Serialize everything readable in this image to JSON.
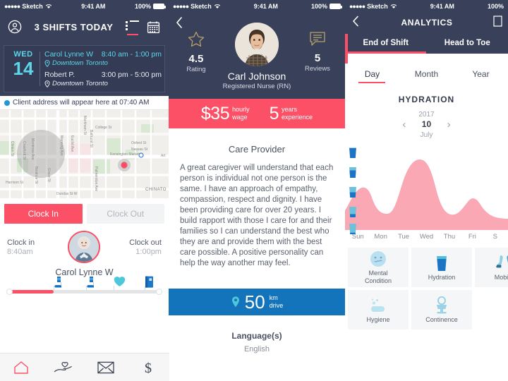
{
  "statusbar": {
    "carrier": "Sketch",
    "dots": "●●●●●",
    "time": "9:41 AM",
    "battery": "100%"
  },
  "colors": {
    "navy": "#39405a",
    "accent_red": "#fb5066",
    "cyan": "#5fd6e8",
    "blue": "#1373bb",
    "pink_area": "#f9a8b4"
  },
  "panel1": {
    "name": "shifts-screen",
    "header": {
      "title": "3 SHIFTS TODAY",
      "profile_icon": "person-circle-icon",
      "list_icon": "list-view-icon",
      "calendar_icon": "calendar-icon"
    },
    "shift_card": {
      "day_of_week": "WED",
      "day_number": "14",
      "shifts": [
        {
          "client": "Carol Lynne W",
          "time": "8:40 am - 1:00 pm",
          "location": "Downtown Toronto",
          "state": "active"
        },
        {
          "client": "Robert P.",
          "time": "3:00 pm - 5:00 pm",
          "location": "Downtown Toronto",
          "state": "idle"
        }
      ]
    },
    "address_bar": {
      "text": "Client address will appear here at 07:40 AM",
      "dot_icon": "location-dot-icon"
    },
    "map": {
      "marker_label": "Kensington Market",
      "district_label": "CHINATO",
      "streets": [
        "College St",
        "Oxford St",
        "Nassau St",
        "Dundas St W",
        "Bathurst St",
        "Euclid Ave",
        "Manning Ave",
        "Markham St",
        "Palmerston Ave",
        "Grace St",
        "Crawford St",
        "Beatrice St",
        "Montrose Ave",
        "Harrison St",
        "Clinton St",
        "Art"
      ]
    },
    "buttons": {
      "clock_in": "Clock In",
      "clock_out": "Clock Out"
    },
    "clock_info": {
      "in_label": "Clock in",
      "in_value": "8:40am",
      "out_label": "Clock out",
      "out_value": "1:00pm",
      "client_name": "Carol Lynne W",
      "avatar_icon": "client-avatar"
    },
    "progress": {
      "fill_percent": 30,
      "markers": [
        {
          "icon": "boot-icon",
          "position": 38
        },
        {
          "icon": "boot-icon",
          "position": 57
        },
        {
          "icon": "heart-icon",
          "position": 74
        },
        {
          "icon": "book-icon",
          "position": 92
        }
      ]
    },
    "tabbar": [
      {
        "icon": "home-icon",
        "name": "tab-home",
        "active": true
      },
      {
        "icon": "care-hand-heart-icon",
        "name": "tab-care",
        "active": false
      },
      {
        "icon": "envelope-icon",
        "name": "tab-messages",
        "active": false
      },
      {
        "icon": "dollar-icon",
        "name": "tab-payments",
        "active": false
      }
    ]
  },
  "panel2": {
    "name": "caregiver-profile-screen",
    "back_icon": "chevron-left-icon",
    "rating": {
      "value": "4.5",
      "label": "Rating",
      "icon": "star-icon"
    },
    "reviews": {
      "value": "5",
      "label": "Reviews",
      "icon": "chat-bubble-icon"
    },
    "profile": {
      "name": "Carl Johnson",
      "role": "Registered Nurse (RN)",
      "photo_icon": "caregiver-photo"
    },
    "wage": {
      "amount": "$35",
      "amount_label_line1": "hourly",
      "amount_label_line2": "wage",
      "years": "5",
      "years_label_line1": "years",
      "years_label_line2": "experience"
    },
    "section_title": "Care Provider",
    "bio": "A great caregiver will understand that each person is individual not one person is the same. I have an approach of empathy, compassion, respect and dignity. I have been providing care for over 20 years. I build rapport with those I care for and their families so I can understand the best who they are and provide them with the best care possible. A positive personality can help the way another may feel.",
    "drive": {
      "pin_icon": "location-pin-icon",
      "value": "50",
      "unit_line1": "km",
      "unit_line2": "drive"
    },
    "languages": {
      "title": "Language(s)",
      "value": "English"
    }
  },
  "panel3": {
    "name": "analytics-screen",
    "nav": {
      "back_icon": "chevron-left-icon",
      "title": "ANALYTICS",
      "action_icon": "share-icon"
    },
    "tabs": [
      {
        "label": "End of Shift",
        "active": true
      },
      {
        "label": "Head to Toe",
        "active": false
      }
    ],
    "periods": [
      {
        "label": "Day",
        "active": true
      },
      {
        "label": "Month",
        "active": false
      },
      {
        "label": "Year",
        "active": false
      }
    ],
    "chart_title": "HYDRATION",
    "date": {
      "year": "2017",
      "day": "10",
      "month": "July",
      "prev_icon": "chevron-left-icon",
      "next_icon": "chevron-right-icon"
    },
    "care_cards": [
      [
        {
          "label": "Mental\nCondition",
          "icon": "face-icon"
        },
        {
          "label": "Hydration",
          "icon": "water-glass-icon"
        },
        {
          "label": "Mobility",
          "icon": "legs-walking-icon"
        }
      ],
      [
        {
          "label": "Hygiene",
          "icon": "soap-bubbles-icon"
        },
        {
          "label": "Continence",
          "icon": "toilet-icon"
        }
      ]
    ],
    "chart_data": {
      "type": "area",
      "title": "HYDRATION",
      "xlabel": "",
      "ylabel": "",
      "categories": [
        "Sun",
        "Mon",
        "Tue",
        "Wed",
        "Thu",
        "Fri",
        "S"
      ],
      "values": [
        3.0,
        1.2,
        4.0,
        5.0,
        1.0,
        2.0,
        1.0
      ],
      "ylim": [
        0,
        5
      ],
      "y_tick_icons": [
        "glass-full",
        "glass-3q",
        "glass-half",
        "glass-quarter",
        "glass-low"
      ],
      "grid": false,
      "legend": "none",
      "area_color": "#f9a8b4",
      "smoothing": "spline"
    }
  }
}
